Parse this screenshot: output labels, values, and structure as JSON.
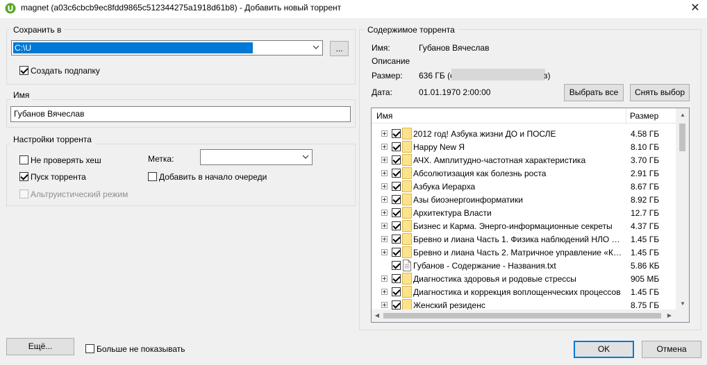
{
  "title_bar": {
    "title": "magnet (a03c6cbcb9ec8fdd9865c512344275a1918d61b8) - Добавить новый торрент",
    "app_icon": "utorrent-logo-icon",
    "close_icon": "close-icon",
    "close_glyph": "✕"
  },
  "save": {
    "group_label": "Сохранить в",
    "path_value": "C:\\U",
    "browse_label": "...",
    "create_subfolder_label": "Создать подпапку",
    "create_subfolder_checked": true
  },
  "name_group": {
    "group_label": "Имя",
    "name_value": "Губанов Вячеслав"
  },
  "settings": {
    "group_label": "Настройки торрента",
    "skip_hash_label": "Не проверять хеш",
    "skip_hash_checked": false,
    "start_torrent_label": "Пуск торрента",
    "start_torrent_checked": true,
    "altruistic_label": "Альтруистический режим",
    "altruistic_checked": false,
    "label_caption": "Метка:",
    "label_value": "",
    "add_to_top_label": "Добавить в начало очереди",
    "add_to_top_checked": false
  },
  "contents": {
    "group_label": "Содержимое торрента",
    "name_key": "Имя:",
    "name_value": "Губанов Вячеслав",
    "description_key": "Описание",
    "size_key": "Размер:",
    "size_value_start": "636 ГБ (с",
    "size_value_end": "з)",
    "date_key": "Дата:",
    "date_value": "01.01.1970 2:00:00",
    "select_all_label": "Выбрать все",
    "deselect_label": "Снять выбор",
    "columns": {
      "name": "Имя",
      "size": "Размер"
    },
    "files": [
      {
        "name": "2012 год! Азбука жизни ДО и ПОСЛЕ",
        "size": "4.58 ГБ",
        "type": "folder-icon",
        "checked": true
      },
      {
        "name": "Happy New Я",
        "size": "8.10 ГБ",
        "type": "folder-icon",
        "checked": true
      },
      {
        "name": "АЧХ. Амплитудно-частотная характеристика",
        "size": "3.70 ГБ",
        "type": "folder-icon",
        "checked": true
      },
      {
        "name": "Абсолютизация как болезнь роста",
        "size": "2.91 ГБ",
        "type": "folder-icon",
        "checked": true
      },
      {
        "name": "Азбука Иерарха",
        "size": "8.67 ГБ",
        "type": "folder-icon",
        "checked": true
      },
      {
        "name": "Азы биоэнергоинформатики",
        "size": "8.92 ГБ",
        "type": "folder-icon",
        "checked": true
      },
      {
        "name": "Архитектура Власти",
        "size": "12.7 ГБ",
        "type": "folder-icon",
        "checked": true
      },
      {
        "name": "Бизнес и Карма. Энерго-информационные секреты",
        "size": "4.37 ГБ",
        "type": "folder-icon",
        "checked": true
      },
      {
        "name": "Бревно и лиана Часть 1. Физика наблюдений НЛО и к...",
        "size": "1.45 ГБ",
        "type": "folder-icon",
        "checked": true
      },
      {
        "name": "Бревно и лиана Часть 2. Матричное управление «Кан...",
        "size": "1.45 ГБ",
        "type": "folder-icon",
        "checked": true
      },
      {
        "name": "Губанов - Содержание - Названия.txt",
        "size": "5.86 КБ",
        "type": "text-file-icon",
        "checked": true
      },
      {
        "name": "Диагностика здоровья и родовые стрессы",
        "size": "905 МБ",
        "type": "folder-icon",
        "checked": true
      },
      {
        "name": "Диагностика и коррекция воплощенческих процессов",
        "size": "1.45 ГБ",
        "type": "folder-icon",
        "checked": true
      },
      {
        "name": "Женский резиденс",
        "size": "8.75 ГБ",
        "type": "folder-icon",
        "checked": true
      }
    ]
  },
  "footer": {
    "more_label": "Ещё...",
    "dont_show_label": "Больше не показывать",
    "dont_show_checked": false,
    "ok_label": "OK",
    "cancel_label": "Отмена"
  },
  "colors": {
    "window_bg": "#f0f0f0",
    "selection_blue": "#0078d7",
    "folder_yellow": "#ffe38a",
    "utorrent_green": "#5aa628"
  }
}
